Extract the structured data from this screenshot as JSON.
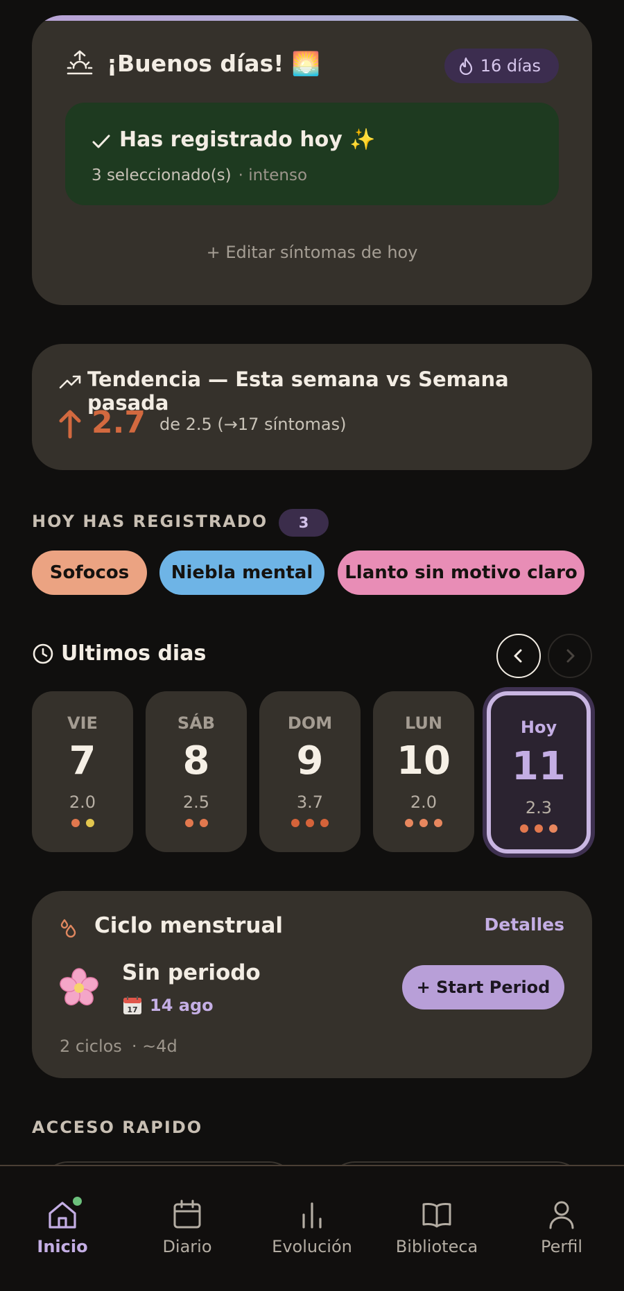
{
  "greeting": {
    "title": "¡Buenos días! 🌅",
    "streak": "16 días",
    "logged_title": "Has registrado hoy ✨",
    "logged_count": "3 seleccionado(s)",
    "logged_intensity": "· intenso",
    "edit_link": "+ Editar síntomas de hoy"
  },
  "trend": {
    "title": "Tendencia — Esta semana vs Semana pasada",
    "value": "2.7",
    "detail": "de 2.5 (→17 síntomas)"
  },
  "today": {
    "label": "HOY HAS REGISTRADO",
    "count": "3",
    "chips": [
      {
        "label": "Sofocos",
        "color": "#eba382"
      },
      {
        "label": "Niebla mental",
        "color": "#6eb4e6"
      },
      {
        "label": "Llanto sin motivo claro",
        "color": "#e88db6"
      }
    ]
  },
  "recent": {
    "title": "Ultimos dias",
    "days": [
      {
        "name": "VIE",
        "num": "7",
        "score": "2.0",
        "dots": [
          "#e2784e",
          "#e2c64e"
        ]
      },
      {
        "name": "SÁB",
        "num": "8",
        "score": "2.5",
        "dots": [
          "#e2784e",
          "#e2784e"
        ]
      },
      {
        "name": "DOM",
        "num": "9",
        "score": "3.7",
        "dots": [
          "#d5633a",
          "#d5633a",
          "#d5633a"
        ]
      },
      {
        "name": "LUN",
        "num": "10",
        "score": "2.0",
        "dots": [
          "#e8875e",
          "#e8875e",
          "#e8875e"
        ]
      },
      {
        "name": "Hoy",
        "num": "11",
        "score": "2.3",
        "dots": [
          "#e2784e",
          "#e2784e",
          "#e8875e"
        ]
      }
    ]
  },
  "cycle": {
    "title": "Ciclo menstrual",
    "details": "Detalles",
    "status": "Sin periodo",
    "date": "14 ago",
    "button": "+ Start Period",
    "cycles": "2 ciclos",
    "avg": "· ~4d"
  },
  "quick": {
    "label": "ACCESO RAPIDO"
  },
  "nav": [
    {
      "label": "Inicio",
      "icon": "home-icon"
    },
    {
      "label": "Diario",
      "icon": "calendar-icon"
    },
    {
      "label": "Evolución",
      "icon": "bar-chart-icon"
    },
    {
      "label": "Biblioteca",
      "icon": "book-icon"
    },
    {
      "label": "Perfil",
      "icon": "user-icon"
    }
  ],
  "colors": {
    "accent": "#c4aee4",
    "trend_up": "#d2693f",
    "logged_bg": "#1e3a20"
  }
}
